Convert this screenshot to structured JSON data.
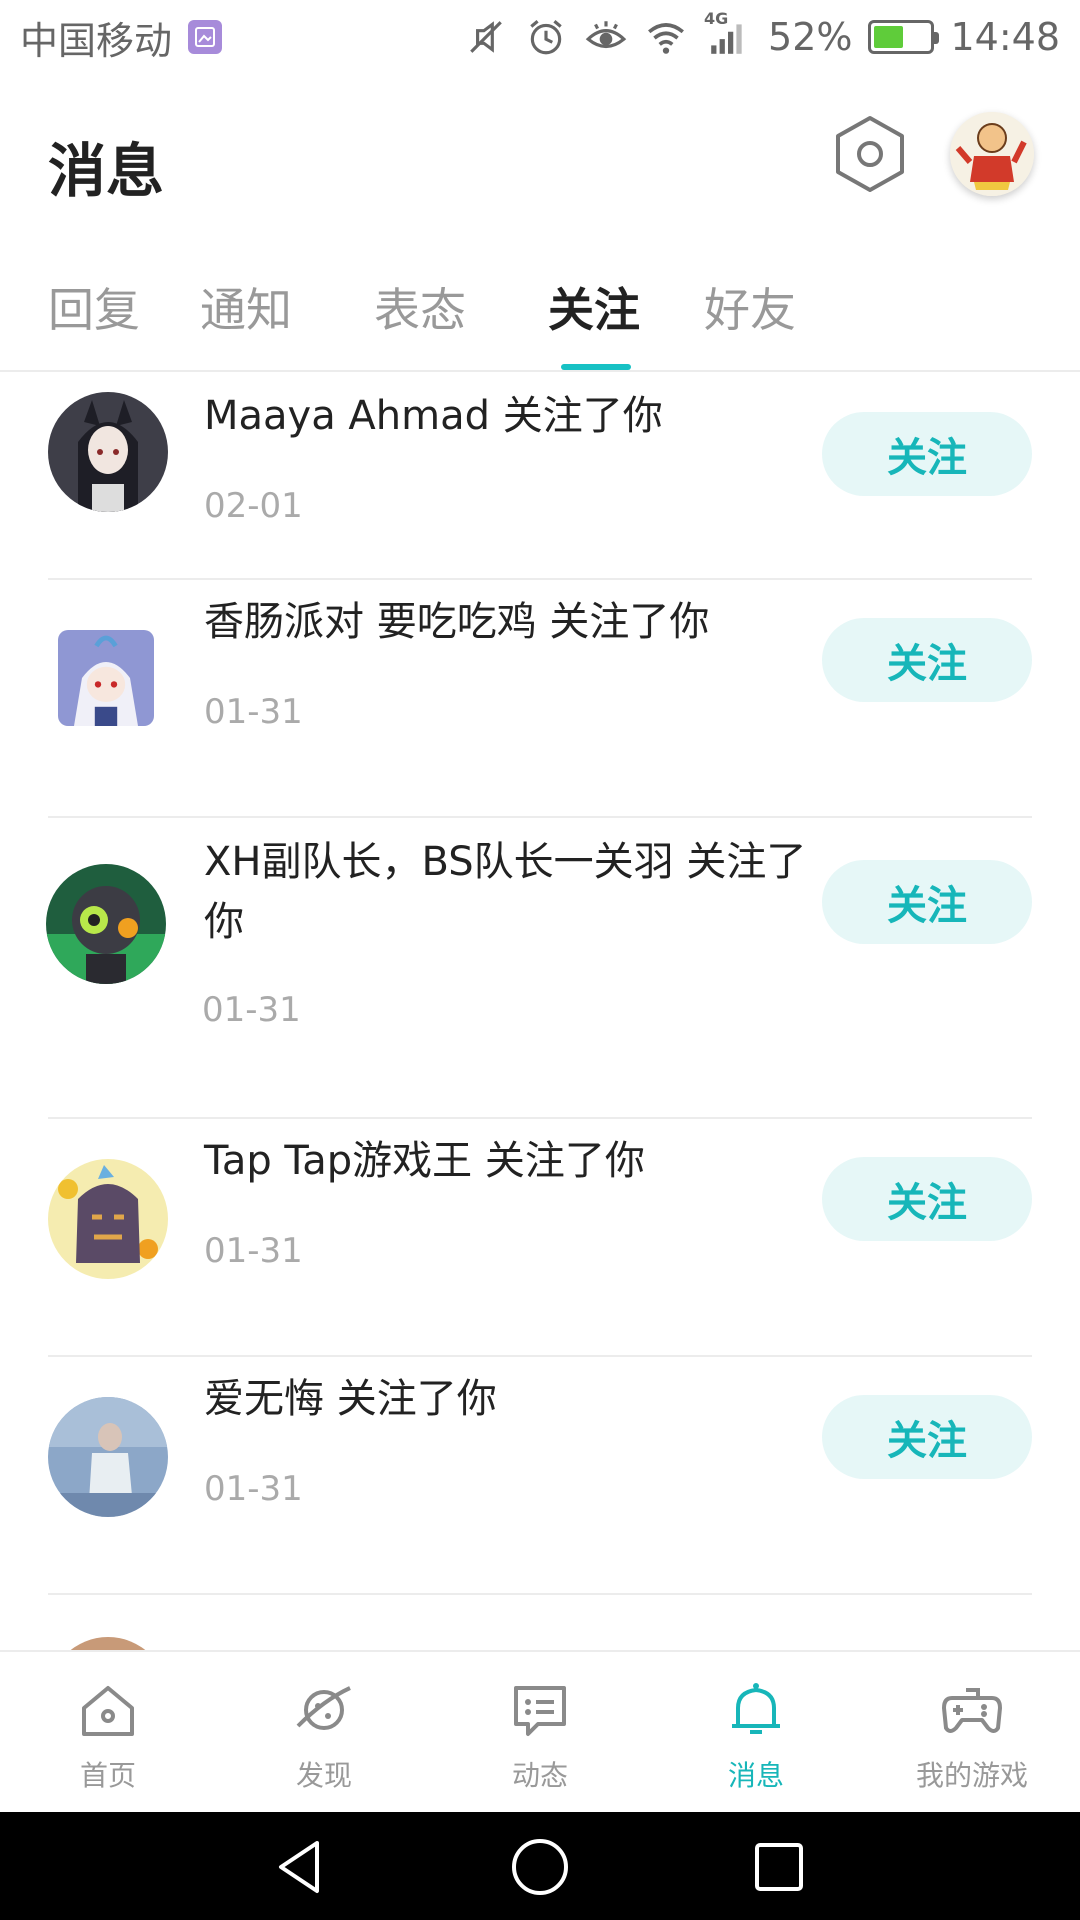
{
  "status_bar": {
    "carrier": "中国移动",
    "network": "4G",
    "battery": "52%",
    "time": "14:48",
    "battery_level": 0.52
  },
  "header": {
    "title": "消息"
  },
  "tabs": [
    {
      "label": "回复"
    },
    {
      "label": "通知"
    },
    {
      "label": "表态"
    },
    {
      "label": "关注",
      "active": true
    },
    {
      "label": "好友"
    }
  ],
  "follows": [
    {
      "message": "Maaya Ahmad 关注了你",
      "date": "02-01",
      "button": "关注"
    },
    {
      "message": "香肠派对 要吃吃鸡 关注了你",
      "date": "01-31",
      "button": "关注"
    },
    {
      "message": "XH副队长，BS队长一关羽 关注了你",
      "date": "01-31",
      "button": "关注"
    },
    {
      "message": "Tap Tap游戏王 关注了你",
      "date": "01-31",
      "button": "关注"
    },
    {
      "message": "爱无悔 关注了你",
      "date": "01-31",
      "button": "关注"
    }
  ],
  "bottom_nav": [
    {
      "label": "首页",
      "icon": "home-icon"
    },
    {
      "label": "发现",
      "icon": "planet-icon"
    },
    {
      "label": "动态",
      "icon": "chat-icon"
    },
    {
      "label": "消息",
      "icon": "bell-icon",
      "active": true
    },
    {
      "label": "我的游戏",
      "icon": "gamepad-icon"
    }
  ],
  "colors": {
    "accent": "#17b6b9",
    "button_bg": "#e6f7f7",
    "date_text": "#aaaaaa"
  }
}
